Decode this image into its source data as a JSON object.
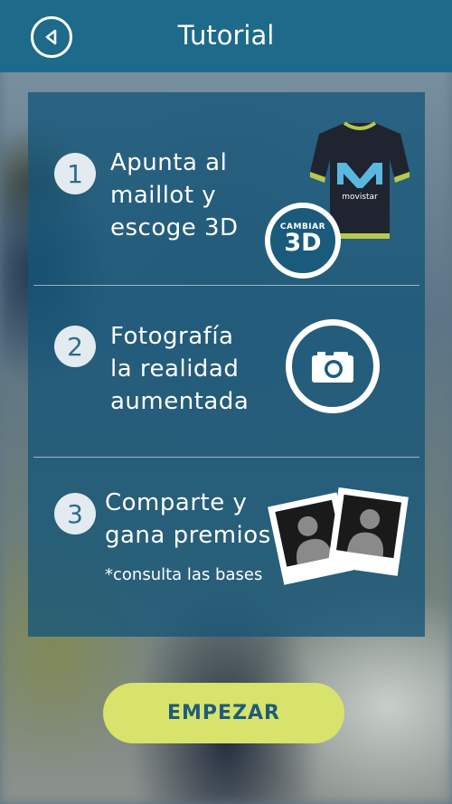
{
  "header": {
    "title": "Tutorial",
    "back_icon": "back-arrow-icon"
  },
  "steps": [
    {
      "number": "1",
      "lines": [
        "Apunta al",
        "maillot y",
        "escoge 3D"
      ],
      "badge_small": "CAMBIAR",
      "badge_big": "3D",
      "jersey_text": "movistar"
    },
    {
      "number": "2",
      "lines": [
        "Fotografía",
        "la realidad",
        "aumentada"
      ],
      "icon": "camera-icon"
    },
    {
      "number": "3",
      "lines": [
        "Comparte y",
        "gana premios"
      ],
      "note": "*consulta las bases",
      "icon": "photos-icon"
    }
  ],
  "actions": {
    "start_label": "EMPEZAR"
  },
  "colors": {
    "header": "#1d6a8a",
    "panel": "#155679",
    "button": "#d7e36b",
    "button_text": "#1f5c7b"
  }
}
